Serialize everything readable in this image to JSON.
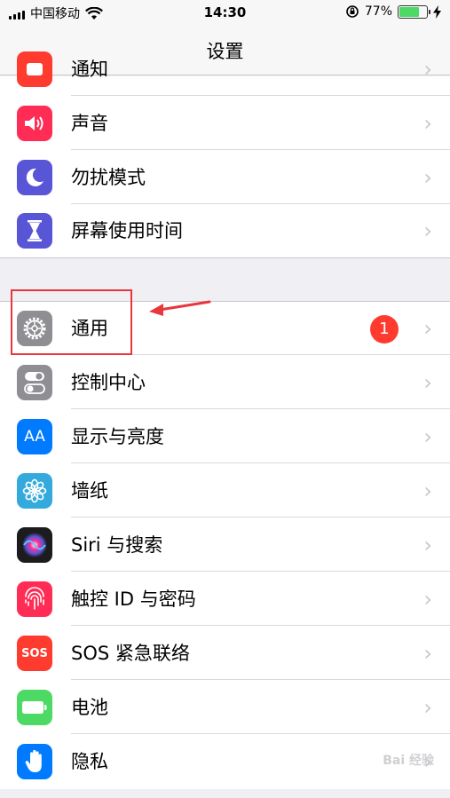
{
  "status_bar": {
    "carrier": "中国移动",
    "time": "14:30",
    "battery_percent": "77%",
    "battery_level": 0.77
  },
  "nav": {
    "title": "设置"
  },
  "group1": {
    "partial_label": "通知",
    "items": [
      {
        "label": "声音",
        "icon": "speaker-icon",
        "color": "#ff2d55"
      },
      {
        "label": "勿扰模式",
        "icon": "moon-icon",
        "color": "#5856d6"
      },
      {
        "label": "屏幕使用时间",
        "icon": "hourglass-icon",
        "color": "#5856d6"
      }
    ]
  },
  "group2": {
    "items": [
      {
        "label": "通用",
        "icon": "gear-icon",
        "color": "#8e8e93",
        "badge": "1"
      },
      {
        "label": "控制中心",
        "icon": "toggles-icon",
        "color": "#8e8e93"
      },
      {
        "label": "显示与亮度",
        "icon": "text-size-icon",
        "color": "#007aff",
        "icon_text": "AA"
      },
      {
        "label": "墙纸",
        "icon": "flower-icon",
        "color": "#34aadc"
      },
      {
        "label": "Siri 与搜索",
        "icon": "siri-icon",
        "color": "#1c1c1e"
      },
      {
        "label": "触控 ID 与密码",
        "icon": "fingerprint-icon",
        "color": "#ff2d55"
      },
      {
        "label": "SOS 紧急联络",
        "icon": "sos-icon",
        "color": "#ff3b30",
        "icon_text": "SOS"
      },
      {
        "label": "电池",
        "icon": "battery-icon",
        "color": "#4cd964"
      },
      {
        "label": "隐私",
        "icon": "hand-icon",
        "color": "#007aff"
      }
    ]
  },
  "watermark": "Bai 经验"
}
